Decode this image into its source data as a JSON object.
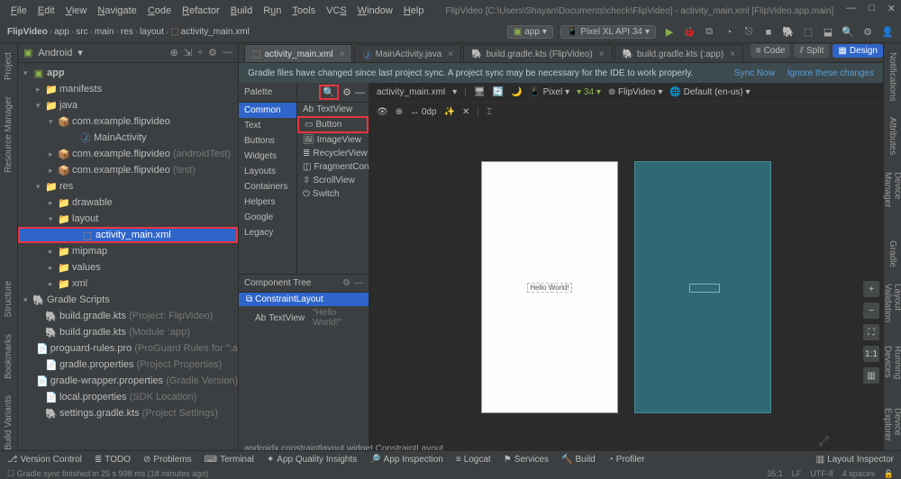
{
  "menu": [
    "File",
    "Edit",
    "View",
    "Navigate",
    "Code",
    "Refactor",
    "Build",
    "Run",
    "Tools",
    "VCS",
    "Window",
    "Help"
  ],
  "title": "FlipVideo [C:\\Users\\Shayan\\Documents\\check\\FlipVideo] - activity_main.xml [FlipVideo.app.main]",
  "breadcrumb": [
    "FlipVideo",
    "app",
    "src",
    "main",
    "res",
    "layout",
    "activity_main.xml"
  ],
  "toolbar": {
    "app_label": "app",
    "device_label": "Pixel XL API 34"
  },
  "left_tabs": [
    "Project",
    "Resource Manager"
  ],
  "left_tabs2": [
    "Structure",
    "Bookmarks",
    "Build Variants"
  ],
  "right_tabs": [
    "Notifications",
    "Attributes",
    "Device Manager"
  ],
  "right_tabs2": [
    "Gradle",
    "Layout Validation",
    "Running Devices",
    "Device Explorer"
  ],
  "project": {
    "dropdown": "Android",
    "tree": {
      "app": "app",
      "manifests": "manifests",
      "java": "java",
      "pkg1": "com.example.flipvideo",
      "main_activity": "MainActivity",
      "pkg2": "com.example.flipvideo",
      "pkg2_suffix": "(androidTest)",
      "pkg3": "com.example.flipvideo",
      "pkg3_suffix": "(test)",
      "res": "res",
      "drawable": "drawable",
      "layout": "layout",
      "activity_main": "activity_main.xml",
      "mipmap": "mipmap",
      "values": "values",
      "xml": "xml",
      "gradle_scripts": "Gradle Scripts",
      "bg1": "build.gradle.kts",
      "bg1_suffix": "(Project: FlipVideo)",
      "bg2": "build.gradle.kts",
      "bg2_suffix": "(Module :app)",
      "pg": "proguard-rules.pro",
      "pg_suffix": "(ProGuard Rules for \":app\")",
      "gp": "gradle.properties",
      "gp_suffix": "(Project Properties)",
      "gw": "gradle-wrapper.properties",
      "gw_suffix": "(Gradle Version)",
      "lp": "local.properties",
      "lp_suffix": "(SDK Location)",
      "sg": "settings.gradle.kts",
      "sg_suffix": "(Project Settings)"
    }
  },
  "tabs": [
    {
      "label": "activity_main.xml",
      "active": true
    },
    {
      "label": "MainActivity.java",
      "active": false
    },
    {
      "label": "build.gradle.kts (FlipVideo)",
      "active": false
    },
    {
      "label": "build.gradle.kts (:app)",
      "active": false
    }
  ],
  "sync": {
    "msg": "Gradle files have changed since last project sync. A project sync may be necessary for the IDE to work properly.",
    "link1": "Sync Now",
    "link2": "Ignore these changes"
  },
  "mode": {
    "code": "Code",
    "split": "Split",
    "design": "Design"
  },
  "palette": {
    "title": "Palette",
    "cats": [
      "Common",
      "Text",
      "Buttons",
      "Widgets",
      "Layouts",
      "Containers",
      "Helpers",
      "Google",
      "Legacy"
    ],
    "widgets": [
      "TextView",
      "Button",
      "ImageView",
      "RecyclerView",
      "FragmentCon...",
      "ScrollView",
      "Switch"
    ]
  },
  "canvas": {
    "file": "activity_main.xml",
    "pixel": "Pixel",
    "api": "34",
    "theme": "FlipVideo",
    "locale": "Default (en-us)",
    "dp": "0dp",
    "hello": "Hello World!"
  },
  "comp_tree": {
    "title": "Component Tree",
    "root": "ConstraintLayout",
    "child": "TextView",
    "child_text": "\"Hello World!\""
  },
  "status_hint": "androidx.constraintlayout.widget.ConstraintLayout",
  "statusbar": {
    "vc": "Version Control",
    "todo": "TODO",
    "problems": "Problems",
    "terminal": "Terminal",
    "aqi": "App Quality Insights",
    "ai": "App Inspection",
    "logcat": "Logcat",
    "services": "Services",
    "build": "Build",
    "profiler": "Profiler",
    "li": "Layout Inspector"
  },
  "statusbar2": {
    "msg": "Gradle sync finished in 25 s 998 ms (18 minutes ago)",
    "pos": "35:1",
    "lf": "LF",
    "enc": "UTF-8",
    "indent": "4 spaces"
  }
}
